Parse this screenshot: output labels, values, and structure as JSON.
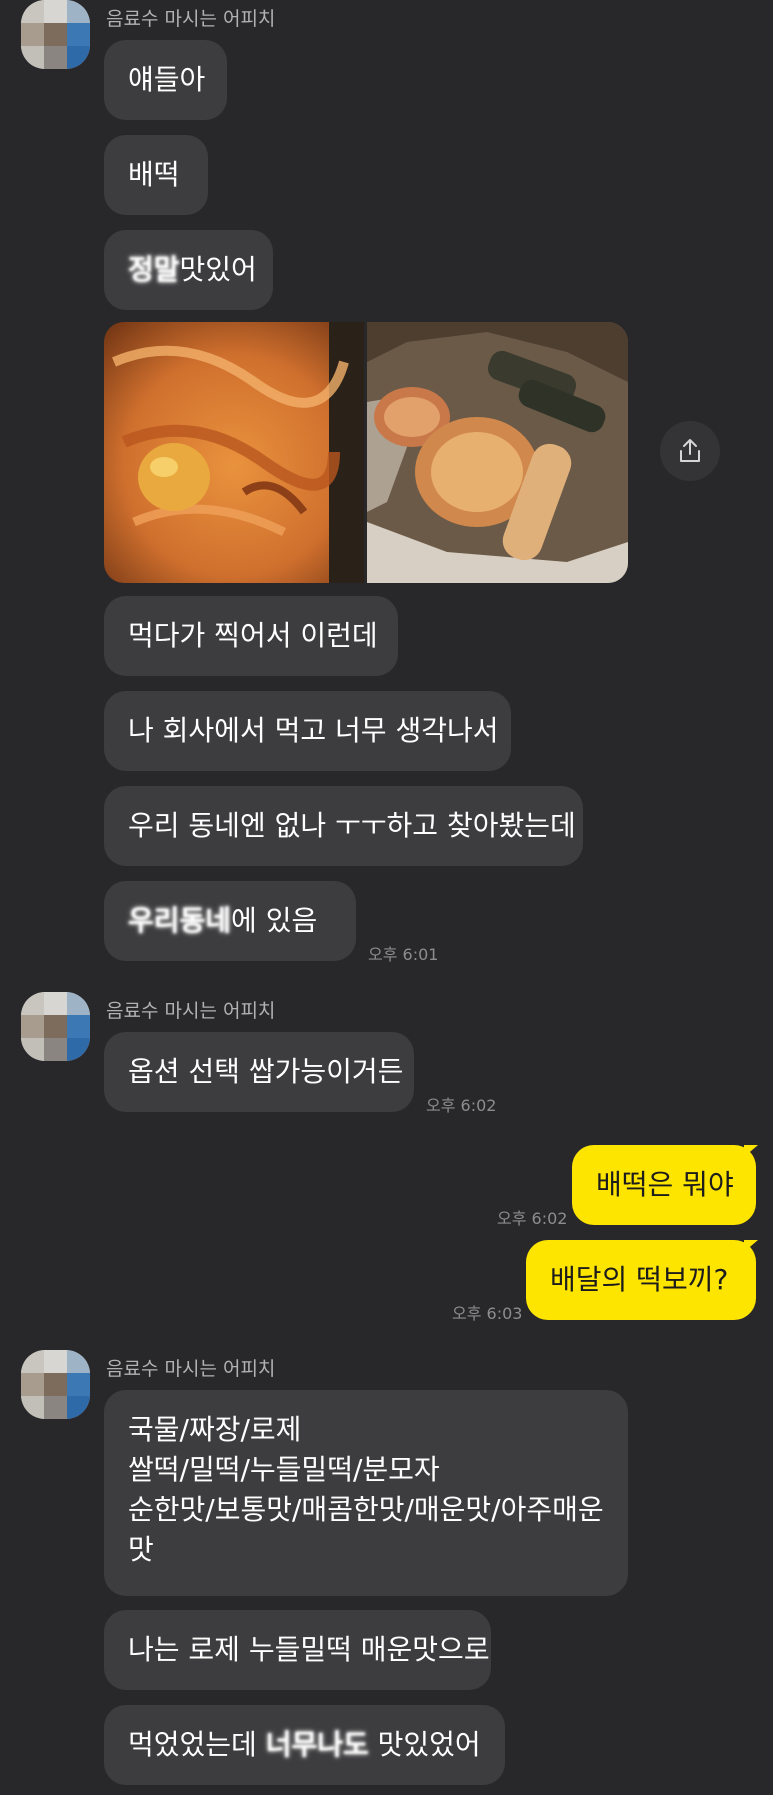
{
  "chat": {
    "sender_name": "음료수 마시는 어피치",
    "group1": {
      "messages": [
        "얘들아",
        "배떡"
      ],
      "m3_blur": "정말",
      "m3_rest": "맛있어",
      "m4": "먹다가 찍어서 이런데",
      "m5": "나 회사에서 먹고 너무 생각나서",
      "m6": "우리 동네엔 없나 ㅜㅜ하고 찾아봤는데",
      "m7_blur": "우리동네",
      "m7_rest": " 에 있음",
      "time": "오후 6:01"
    },
    "group2": {
      "m1": "옵션 선택 쌉가능이거든",
      "time": "오후 6:02"
    },
    "mine": [
      {
        "text": "배떡은 뭐야",
        "time": "오후 6:02"
      },
      {
        "text": "배달의 떡보끼?",
        "time": "오후 6:03"
      }
    ],
    "group3": {
      "lines": [
        "국물/짜장/로제",
        "쌀떡/밀떡/누들밀떡/분모자",
        "순한맛/보통맛/매콤한맛/매운맛/아주매운",
        "맛"
      ],
      "m2": "나는 로제 누들밀떡 매운맛으로",
      "m3_pre": "먹었었는데 ",
      "m3_blur": "너무나도",
      "m3_post": " 맛있었어"
    }
  },
  "icons": {
    "share": "share-upload-icon",
    "avatar": "pixelated-avatar"
  },
  "colors": {
    "background": "#28282a",
    "their_bubble": "#3d3d3f",
    "my_bubble": "#fee500"
  }
}
